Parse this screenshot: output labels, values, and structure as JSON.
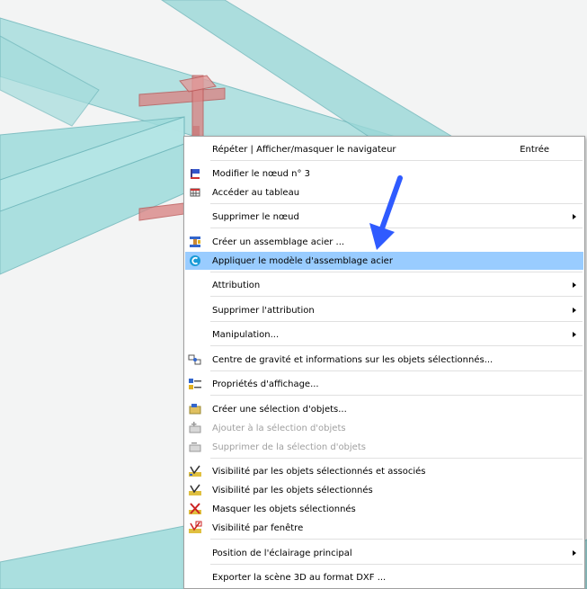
{
  "colors": {
    "beam_fill": "#9edcdc",
    "beam_edge": "#6fb7bb",
    "node_fill": "#d98787",
    "highlight": "#99ccff",
    "pointer": "#2f5bff"
  },
  "context_menu": {
    "items": [
      {
        "label": "Répéter | Afficher/masquer le navigateur",
        "shortcut": "Entrée",
        "icon": "none",
        "submenu": false,
        "disabled": false
      },
      {
        "label": "Modifier le nœud n° 3",
        "icon": "edit-node-icon",
        "submenu": false,
        "disabled": false
      },
      {
        "label": "Accéder au tableau",
        "icon": "table-icon",
        "submenu": false,
        "disabled": false
      },
      {
        "label": "Supprimer le nœud",
        "icon": "none",
        "submenu": true,
        "disabled": false
      },
      {
        "label": "Créer un assemblage acier ...",
        "icon": "steel-connection-icon",
        "submenu": false,
        "disabled": false
      },
      {
        "label": "Appliquer le modèle d'assemblage acier",
        "icon": "apply-template-icon",
        "submenu": false,
        "disabled": false,
        "highlighted": true
      },
      {
        "label": "Attribution",
        "icon": "none",
        "submenu": true,
        "disabled": false
      },
      {
        "label": "Supprimer l'attribution",
        "icon": "none",
        "submenu": true,
        "disabled": false
      },
      {
        "label": "Manipulation...",
        "icon": "none",
        "submenu": true,
        "disabled": false
      },
      {
        "label": "Centre de gravité et informations sur les objets sélectionnés...",
        "icon": "center-of-gravity-icon",
        "submenu": false,
        "disabled": false
      },
      {
        "label": "Propriétés d'affichage...",
        "icon": "display-properties-icon",
        "submenu": false,
        "disabled": false
      },
      {
        "label": "Créer une sélection d'objets...",
        "icon": "create-selection-icon",
        "submenu": false,
        "disabled": false
      },
      {
        "label": "Ajouter à la sélection d'objets",
        "icon": "add-selection-icon",
        "submenu": false,
        "disabled": true
      },
      {
        "label": "Supprimer de la sélection d'objets",
        "icon": "remove-selection-icon",
        "submenu": false,
        "disabled": true
      },
      {
        "label": "Visibilité par les objets sélectionnés et associés",
        "icon": "visibility-associated-icon",
        "submenu": false,
        "disabled": false
      },
      {
        "label": "Visibilité par les objets sélectionnés",
        "icon": "visibility-selected-icon",
        "submenu": false,
        "disabled": false
      },
      {
        "label": "Masquer les objets sélectionnés",
        "icon": "hide-selected-icon",
        "submenu": false,
        "disabled": false
      },
      {
        "label": "Visibilité par fenêtre",
        "icon": "visibility-window-icon",
        "submenu": false,
        "disabled": false
      },
      {
        "label": "Position de l'éclairage principal",
        "icon": "none",
        "submenu": true,
        "disabled": false
      },
      {
        "label": "Exporter la scène 3D au format DXF ...",
        "icon": "none",
        "submenu": false,
        "disabled": false
      }
    ]
  }
}
